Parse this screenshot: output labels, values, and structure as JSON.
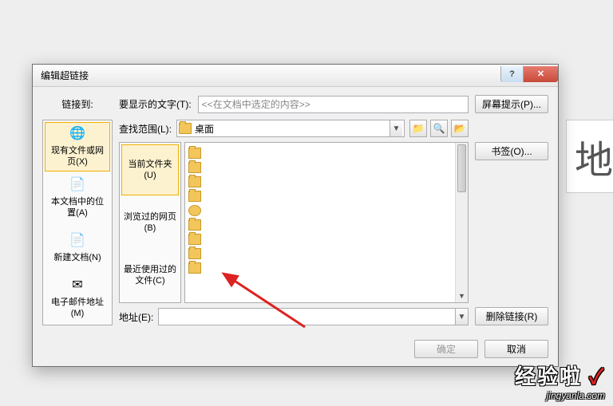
{
  "bg_char": "地",
  "titlebar": {
    "title": "编辑超链接"
  },
  "labels": {
    "link_to": "链接到:",
    "text_to_display": "要显示的文字(T):",
    "lookin": "查找范围(L):",
    "address": "地址(E):"
  },
  "text_display_value": "<<在文档中选定的内容>>",
  "buttons": {
    "screentip": "屏幕提示(P)...",
    "bookmark": "书签(O)...",
    "remove_link": "删除链接(R)",
    "ok": "确定",
    "cancel": "取消"
  },
  "linkto": {
    "items": [
      {
        "label": "现有文件或网页(X)",
        "icon": "🌐"
      },
      {
        "label": "本文档中的位置(A)",
        "icon": "📄"
      },
      {
        "label": "新建文档(N)",
        "icon": "📄"
      },
      {
        "label": "电子邮件地址(M)",
        "icon": "✉"
      }
    ]
  },
  "lookin_value": "桌面",
  "tabs": {
    "items": [
      {
        "label": "当前文件夹(U)"
      },
      {
        "label": "浏览过的网页(B)"
      },
      {
        "label": "最近使用过的文件(C)"
      }
    ]
  },
  "address_value": "",
  "watermark": {
    "top": "经验啦",
    "check": "✓",
    "bottom": "jingyanla.com"
  }
}
